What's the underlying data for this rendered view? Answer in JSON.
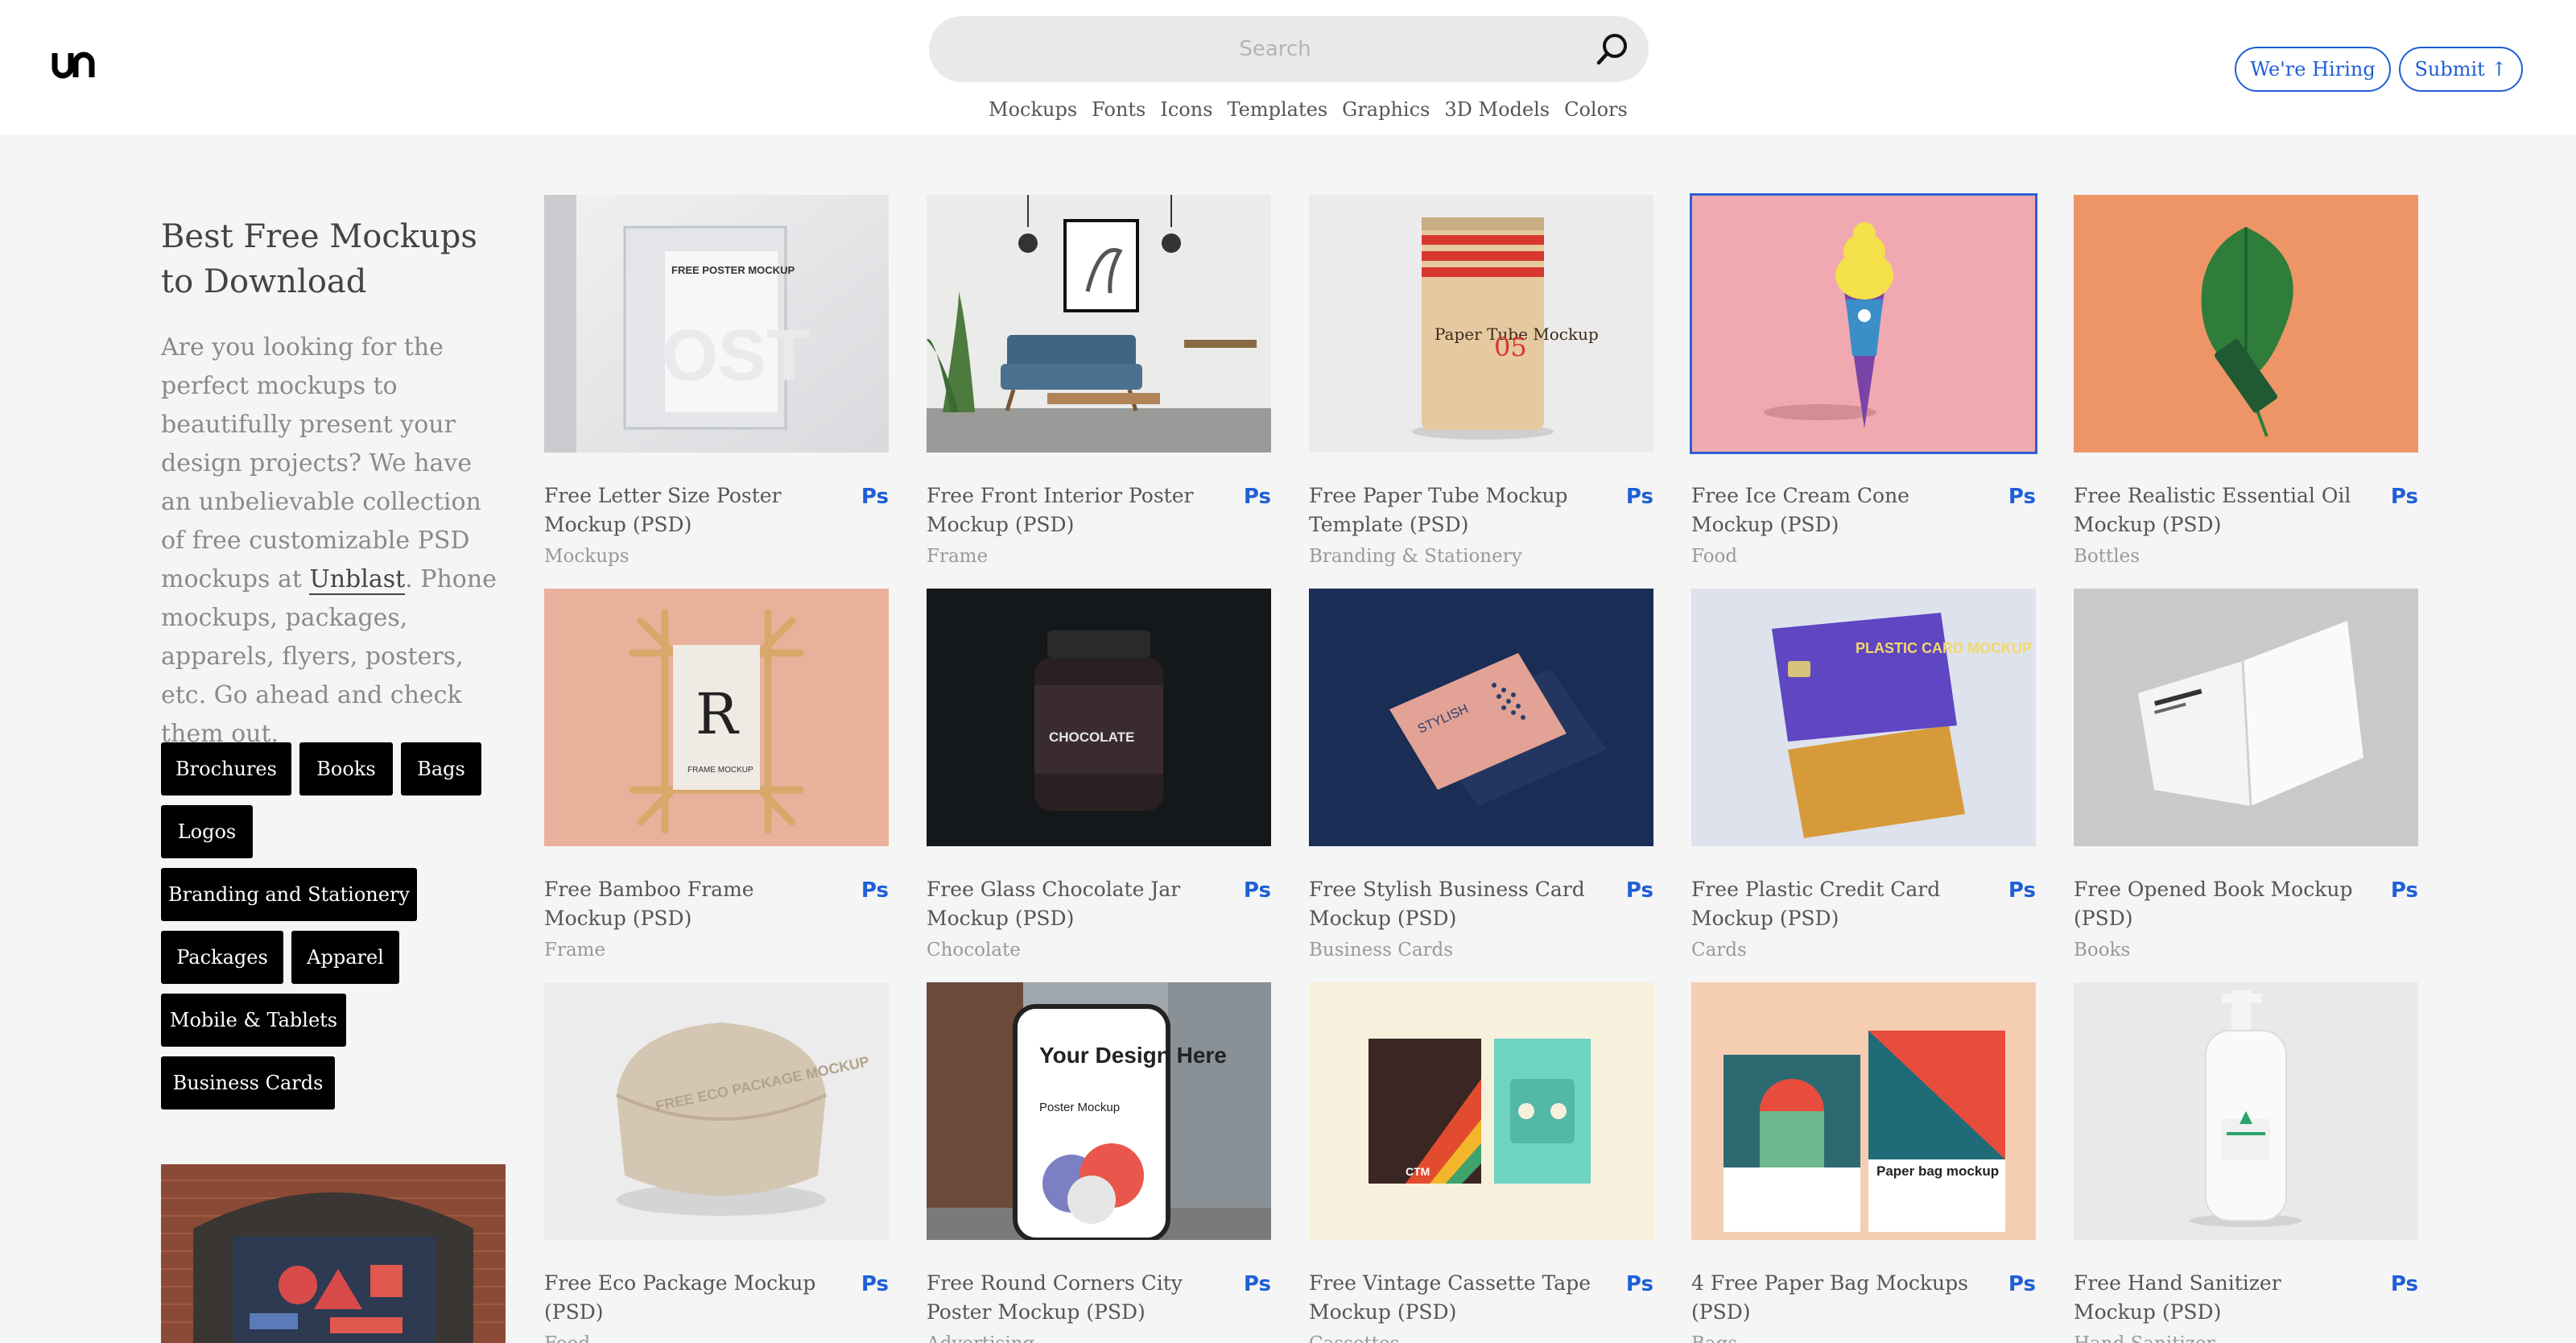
{
  "header": {
    "logo_alt": "un",
    "search_placeholder": "Search",
    "hiring_label": "We're Hiring",
    "submit_label": "Submit",
    "nav": [
      "Mockups",
      "Fonts",
      "Icons",
      "Templates",
      "Graphics",
      "3D Models",
      "Colors"
    ]
  },
  "sidebar": {
    "title": "Best Free Mockups to Download",
    "desc_before": "Are you looking for the perfect mockups to beautifully present your design projects? We have an unbelievable collection of free customizable PSD mockups at ",
    "brand": "Unblast",
    "desc_after": ". Phone mockups, packages, apparels, flyers, posters, etc. Go ahead and check them out.",
    "tags": [
      "Brochures",
      "Books",
      "Bags",
      "Logos",
      "Branding and Stationery",
      "Packages",
      "Apparel",
      "Mobile & Tablets",
      "Business Cards"
    ]
  },
  "badge": "Ps",
  "cards": [
    {
      "title": "Free Letter Size Poster Mockup (PSD)",
      "category": "Mockups",
      "art": "poster",
      "text": "FREE POSTER MOCKUP"
    },
    {
      "title": "Free Front Interior Poster Mockup (PSD)",
      "category": "Frame",
      "art": "interior"
    },
    {
      "title": "Free Paper Tube Mockup Template (PSD)",
      "category": "Branding & Stationery",
      "art": "tube",
      "text": "Paper Tube Mockup",
      "number": "05"
    },
    {
      "title": "Free Ice Cream Cone Mockup (PSD)",
      "category": "Food",
      "art": "icecream"
    },
    {
      "title": "Free Realistic Essential Oil Mockup (PSD)",
      "category": "Bottles",
      "art": "oil"
    },
    {
      "title": "Free Bamboo Frame Mockup (PSD)",
      "category": "Frame",
      "art": "bamboo",
      "text": "FRAME MOCKUP",
      "letter": "R"
    },
    {
      "title": "Free Glass Chocolate Jar Mockup (PSD)",
      "category": "Chocolate",
      "art": "jar",
      "text": "CHOCOLATE"
    },
    {
      "title": "Free Stylish Business Card Mockup (PSD)",
      "category": "Business Cards",
      "art": "bizcard",
      "text": "STYLISH"
    },
    {
      "title": "Free Plastic Credit Card Mockup (PSD)",
      "category": "Cards",
      "art": "credit",
      "text": "PLASTIC CARD MOCKUP"
    },
    {
      "title": "Free Opened Book Mockup (PSD)",
      "category": "Books",
      "art": "book"
    },
    {
      "title": "Free Eco Package Mockup (PSD)",
      "category": "Food",
      "art": "eco",
      "text": "FREE ECO PACKAGE MOCKUP"
    },
    {
      "title": "Free Round Corners City Poster Mockup (PSD)",
      "category": "Advertising",
      "art": "city",
      "text": "Your Design Here",
      "text2": "Poster Mockup"
    },
    {
      "title": "Free Vintage Cassette Tape Mockup (PSD)",
      "category": "Cassettes",
      "art": "cassette",
      "text": "CTM"
    },
    {
      "title": "4 Free Paper Bag Mockups (PSD)",
      "category": "Bags",
      "art": "paperbag",
      "text": "Paper bag mockup"
    },
    {
      "title": "Free Hand Sanitizer Mockup (PSD)",
      "category": "Hand Sanitizer",
      "art": "sanitizer"
    }
  ]
}
